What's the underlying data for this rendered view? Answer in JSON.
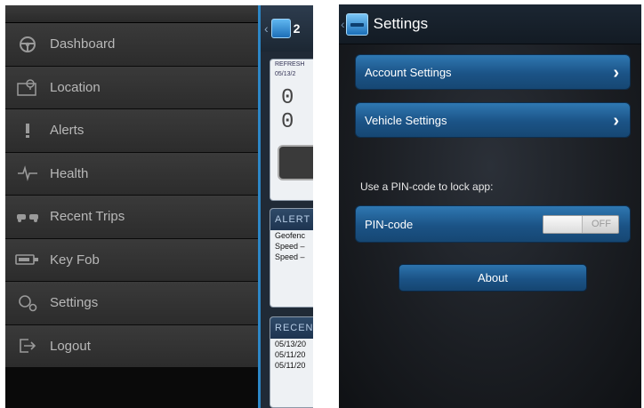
{
  "drawer": {
    "items": [
      {
        "label": "Dashboard",
        "icon": "steering-wheel-icon"
      },
      {
        "label": "Location",
        "icon": "map-pin-icon"
      },
      {
        "label": "Alerts",
        "icon": "exclamation-icon"
      },
      {
        "label": "Health",
        "icon": "heartbeat-icon"
      },
      {
        "label": "Recent Trips",
        "icon": "trips-icon"
      },
      {
        "label": "Key Fob",
        "icon": "key-fob-icon"
      },
      {
        "label": "Settings",
        "icon": "settings-icon"
      },
      {
        "label": "Logout",
        "icon": "logout-icon"
      }
    ]
  },
  "peek": {
    "header_number": "2",
    "refresh_label": "REFRESH",
    "refresh_date": "05/13/2",
    "odometer": "0 0",
    "alerts_header": "ALERT",
    "alert_lines": [
      "Geofenc",
      "Speed –",
      "Speed –"
    ],
    "recent_header": "RECEN",
    "recent_lines": [
      "05/13/20",
      "05/11/20",
      "05/11/20"
    ]
  },
  "settings": {
    "title": "Settings",
    "account_label": "Account Settings",
    "vehicle_label": "Vehicle Settings",
    "pin_caption": "Use a PIN-code to lock app:",
    "pin_label": "PIN-code",
    "pin_state": "OFF",
    "about_label": "About"
  },
  "colors": {
    "accent_blue": "#1b5386",
    "divider_blue": "#2c87c7",
    "drawer_bg": "#2c2c2c"
  }
}
